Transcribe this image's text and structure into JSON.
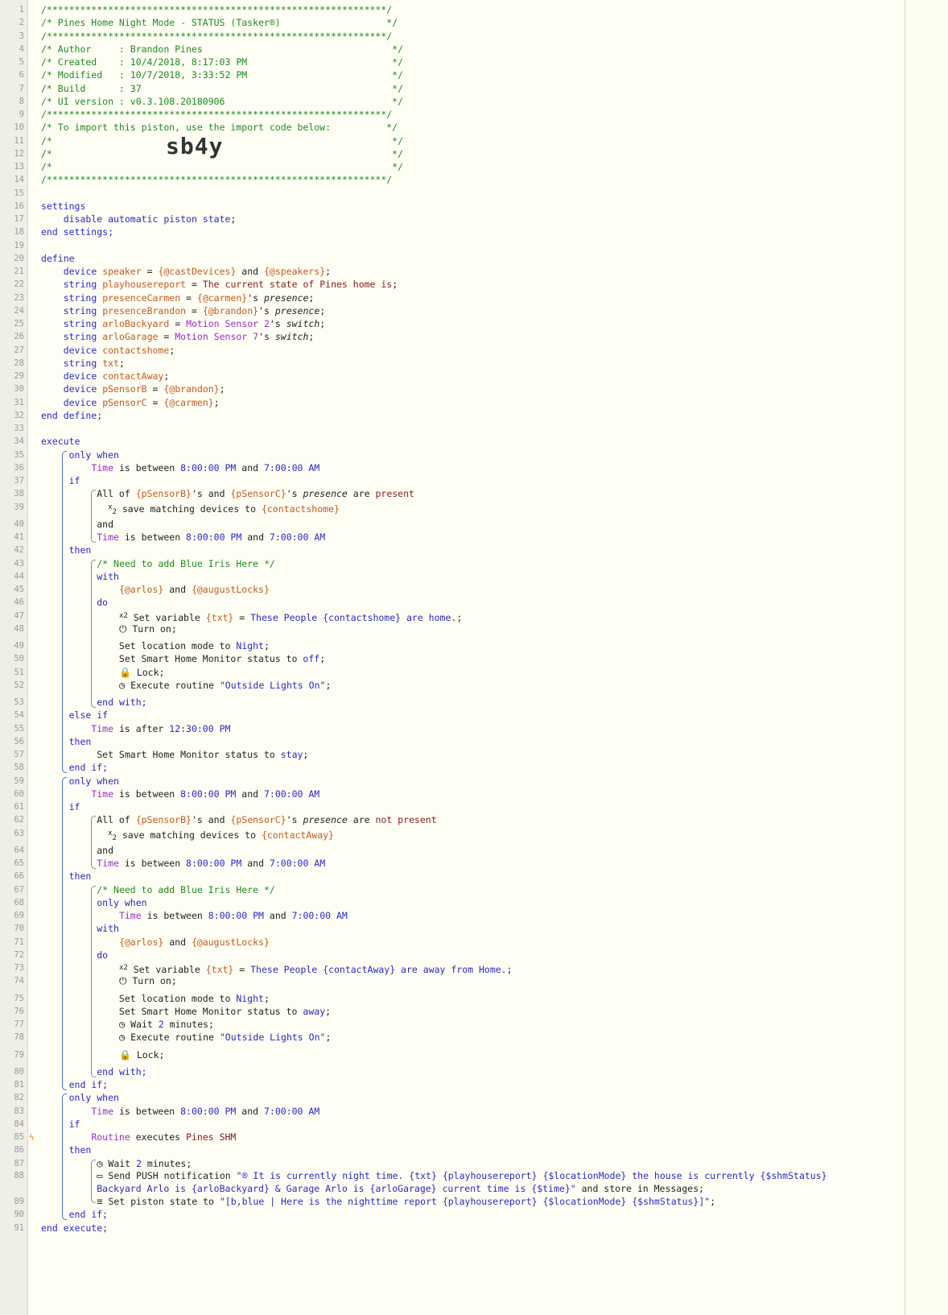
{
  "code_lines": {
    "l1": "/*************************************************************/",
    "l2": "/* Pines Home Night Mode - STATUS (Tasker®)                   */",
    "l3": "/*************************************************************/",
    "l4": "/* Author     : Brandon Pines                                  */",
    "l5": "/* Created    : 10/4/2018, 8:17:03 PM                          */",
    "l6": "/* Modified   : 10/7/2018, 3:33:52 PM                          */",
    "l7": "/* Build      : 37                                             */",
    "l8": "/* UI version : v0.3.108.20180906                              */",
    "l9": "/*************************************************************/",
    "l10": "/* To import this piston, use the import code below:          */",
    "l11": "/*                                                             */",
    "l12": "/*                                                             */",
    "l13": "/*                                                             */",
    "l14": "/*************************************************************/",
    "import_code": "sb4y"
  },
  "kw": {
    "settings": "settings",
    "end_settings": "end settings;",
    "define": "define",
    "end_define": "end define;",
    "execute": "execute",
    "end_execute": "end execute;",
    "only_when": "only when",
    "if": "if",
    "then": "then",
    "else_if": "else if",
    "end_if": "end if;",
    "with": "with",
    "do": "do",
    "end_with": "end with;",
    "and": "and"
  },
  "text": {
    "disable_state": "disable automatic piston state",
    "time": "Time",
    "is_between": " is between ",
    "t8pm": "8:00:00 PM",
    "t7am": "7:00:00 AM",
    "t1230": "12:30:00 PM",
    "all_of": "All of ",
    "psb": "{pSensorB}",
    "psc": "{pSensorC}",
    "presence": "presence",
    "are": " are ",
    "present": "present",
    "not_present": "not present",
    "save_matching": " save matching devices to ",
    "contactshome": "{contactshome}",
    "contactAway": "{contactAway}",
    "comment_blue_iris": "/* Need to add Blue Iris Here */",
    "arlos": "{@arlos}",
    "augustLocks": "{@augustLocks}",
    "set_variable": " Set variable ",
    "txt_var": "{txt}",
    "eq": " = ",
    "these_people_home": "These People {contactshome} are home.",
    "these_people_away": "These People {contactAway} are away from Home.",
    "turn_on": "Turn on;",
    "set_location_mode": "Set location mode to ",
    "night": "Night",
    "set_shm": "Set Smart Home Monitor status to ",
    "off": "off",
    "stay": "stay",
    "away": "away",
    "lock": "Lock;",
    "execute_routine": "Execute routine ",
    "outside_lights": "\"Outside Lights On\"",
    "is_after": " is after ",
    "wait": "Wait ",
    "two": "2",
    "minutes": " minutes;",
    "routine": "Routine",
    "executes": " executes ",
    "pines_shm": "Pines SHM",
    "send_push": "Send PUSH notification ",
    "push_msg_1": "\"® It is currently night time. {txt} {playhousereport} {$locationMode} the house is currently {$shmStatus}",
    "push_msg_2": "Backyard Arlo is {arloBackyard} & Garage Arlo is {arloGarage} current time is {$time}\"",
    "store_in": " and store in Messages;",
    "set_piston_state": "Set piston state to ",
    "piston_state_val": "\"[b,blue | Here is the nighttime report {playhousereport} {$locationMode} {$shmStatus}]\""
  },
  "defs": [
    {
      "type": "device",
      "name": "speaker",
      "val1": "{@castDevices}",
      "mid": " and ",
      "val2": "{@speakers}"
    },
    {
      "type": "string",
      "name": "playhousereport",
      "str": "The current state of Pines home is"
    },
    {
      "type": "string",
      "name": "presenceCarmen",
      "val1": "{@carmen}",
      "attr": "presence"
    },
    {
      "type": "string",
      "name": "presenceBrandon",
      "val1": "{@brandon}",
      "attr": "presence"
    },
    {
      "type": "string",
      "name": "arloBackyard",
      "dev": "Motion Sensor 2",
      "attr": "switch"
    },
    {
      "type": "string",
      "name": "arloGarage",
      "dev": "Motion Sensor 7",
      "attr": "switch"
    },
    {
      "type": "device",
      "name": "contactshome"
    },
    {
      "type": "string",
      "name": "txt"
    },
    {
      "type": "device",
      "name": "contactAway"
    },
    {
      "type": "device",
      "name": "pSensorB",
      "val1": "{@brandon}"
    },
    {
      "type": "device",
      "name": "pSensorC",
      "val1": "{@carmen}"
    }
  ],
  "line_count": 91
}
